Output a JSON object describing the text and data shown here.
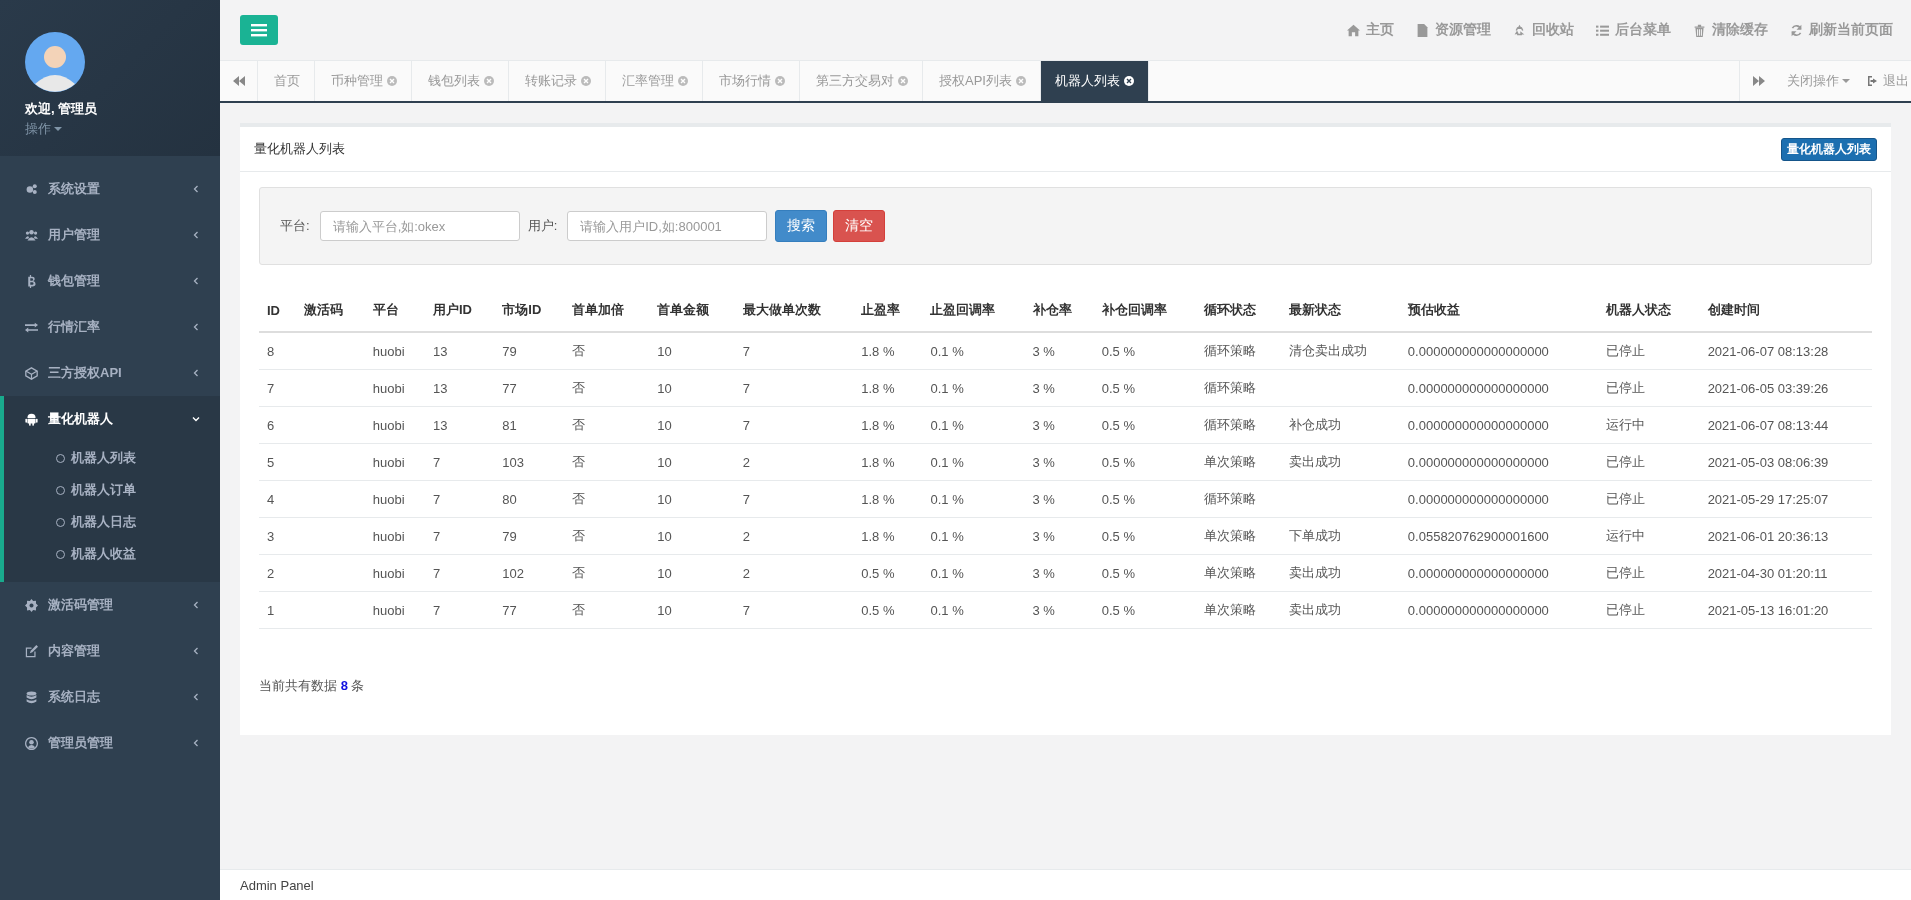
{
  "sidebar": {
    "greeting": "欢迎, 管理员",
    "action": "操作",
    "items": [
      {
        "label": "系统设置",
        "selected": false,
        "expanded": false
      },
      {
        "label": "用户管理",
        "selected": false,
        "expanded": false
      },
      {
        "label": "钱包管理",
        "selected": false,
        "expanded": false
      },
      {
        "label": "行情汇率",
        "selected": false,
        "expanded": false
      },
      {
        "label": "三方授权API",
        "selected": false,
        "expanded": false
      },
      {
        "label": "量化机器人",
        "selected": true,
        "expanded": true,
        "children": [
          {
            "label": "机器人列表"
          },
          {
            "label": "机器人订单"
          },
          {
            "label": "机器人日志"
          },
          {
            "label": "机器人收益"
          }
        ]
      },
      {
        "label": "激活码管理",
        "selected": false,
        "expanded": false
      },
      {
        "label": "内容管理",
        "selected": false,
        "expanded": false
      },
      {
        "label": "系统日志",
        "selected": false,
        "expanded": false
      },
      {
        "label": "管理员管理",
        "selected": false,
        "expanded": false
      }
    ]
  },
  "top_nav": [
    "主页",
    "资源管理",
    "回收站",
    "后台菜单",
    "清除缓存",
    "刷新当前页面"
  ],
  "tabs": [
    {
      "label": "首页",
      "selected": false,
      "closable": false
    },
    {
      "label": "币种管理",
      "selected": false,
      "closable": true
    },
    {
      "label": "钱包列表",
      "selected": false,
      "closable": true
    },
    {
      "label": "转账记录",
      "selected": false,
      "closable": true
    },
    {
      "label": "汇率管理",
      "selected": false,
      "closable": true
    },
    {
      "label": "市场行情",
      "selected": false,
      "closable": true
    },
    {
      "label": "第三方交易对",
      "selected": false,
      "closable": true
    },
    {
      "label": "授权API列表",
      "selected": false,
      "closable": true
    },
    {
      "label": "机器人列表",
      "selected": true,
      "closable": true
    }
  ],
  "tab_actions": {
    "close_menu": "关闭操作",
    "logout": "退出"
  },
  "panel": {
    "title": "量化机器人列表",
    "badge": "量化机器人列表"
  },
  "search": {
    "fields": [
      {
        "label": "平台:",
        "placeholder": "请输入平台,如:okex"
      },
      {
        "label": "用户:",
        "placeholder": "请输入用户ID,如:800001"
      }
    ],
    "search_button": "搜索",
    "clear_button": "清空"
  },
  "table": {
    "columns": [
      "ID",
      "激活码",
      "平台",
      "用户ID",
      "市场ID",
      "首单加倍",
      "首单金额",
      "最大做单次数",
      "止盈率",
      "止盈回调率",
      "补仓率",
      "补仓回调率",
      "循环状态",
      "最新状态",
      "预估收益",
      "机器人状态",
      "创建时间"
    ],
    "rows": [
      [
        "8",
        "",
        "huobi",
        "13",
        "79",
        "否",
        "10",
        "7",
        "1.8 %",
        "0.1 %",
        "3 %",
        "0.5 %",
        "循环策略",
        "清仓卖出成功",
        "0.000000000000000000",
        "已停止",
        "2021-06-07 08:13:28"
      ],
      [
        "7",
        "",
        "huobi",
        "13",
        "77",
        "否",
        "10",
        "7",
        "1.8 %",
        "0.1 %",
        "3 %",
        "0.5 %",
        "循环策略",
        "",
        "0.000000000000000000",
        "已停止",
        "2021-06-05 03:39:26"
      ],
      [
        "6",
        "",
        "huobi",
        "13",
        "81",
        "否",
        "10",
        "7",
        "1.8 %",
        "0.1 %",
        "3 %",
        "0.5 %",
        "循环策略",
        "补仓成功",
        "0.000000000000000000",
        "运行中",
        "2021-06-07 08:13:44"
      ],
      [
        "5",
        "",
        "huobi",
        "7",
        "103",
        "否",
        "10",
        "2",
        "1.8 %",
        "0.1 %",
        "3 %",
        "0.5 %",
        "单次策略",
        "卖出成功",
        "0.000000000000000000",
        "已停止",
        "2021-05-03 08:06:39"
      ],
      [
        "4",
        "",
        "huobi",
        "7",
        "80",
        "否",
        "10",
        "7",
        "1.8 %",
        "0.1 %",
        "3 %",
        "0.5 %",
        "循环策略",
        "",
        "0.000000000000000000",
        "已停止",
        "2021-05-29 17:25:07"
      ],
      [
        "3",
        "",
        "huobi",
        "7",
        "79",
        "否",
        "10",
        "2",
        "1.8 %",
        "0.1 %",
        "3 %",
        "0.5 %",
        "单次策略",
        "下单成功",
        "0.055820762900001600",
        "运行中",
        "2021-06-01 20:36:13"
      ],
      [
        "2",
        "",
        "huobi",
        "7",
        "102",
        "否",
        "10",
        "2",
        "0.5 %",
        "0.1 %",
        "3 %",
        "0.5 %",
        "单次策略",
        "卖出成功",
        "0.000000000000000000",
        "已停止",
        "2021-04-30 01:20:11"
      ],
      [
        "1",
        "",
        "huobi",
        "7",
        "77",
        "否",
        "10",
        "7",
        "0.5 %",
        "0.1 %",
        "3 %",
        "0.5 %",
        "单次策略",
        "卖出成功",
        "0.000000000000000000",
        "已停止",
        "2021-05-13 16:01:20"
      ]
    ]
  },
  "total": "当前共有数据 **8** 条",
  "footer": "Admin Panel"
}
